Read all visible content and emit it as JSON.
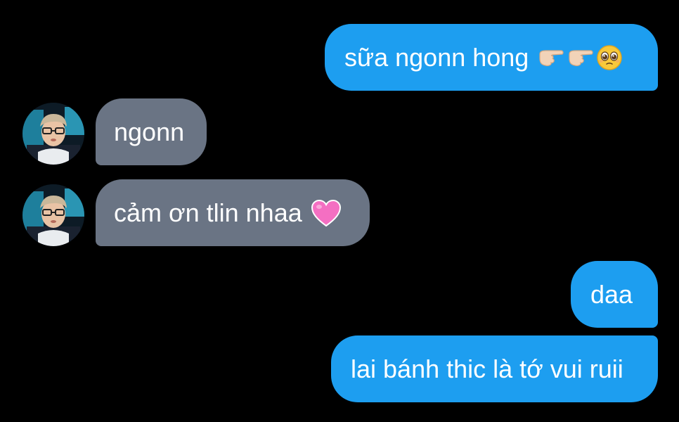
{
  "messages": [
    {
      "id": "m1",
      "direction": "outgoing",
      "text": "sữa ngonn hong",
      "emojis": [
        "backhand-index-pointing-right",
        "backhand-index-pointing-right",
        "pleading-face"
      ]
    },
    {
      "id": "m2",
      "direction": "incoming",
      "text": "ngonn",
      "emojis": []
    },
    {
      "id": "m3",
      "direction": "incoming",
      "text": "cảm ơn tlin nhaa",
      "emojis": [
        "pink-heart"
      ]
    },
    {
      "id": "m4",
      "direction": "outgoing",
      "text": "daa",
      "emojis": []
    },
    {
      "id": "m5",
      "direction": "outgoing",
      "text": "lai bánh thic là tớ vui ruii",
      "emojis": []
    }
  ],
  "colors": {
    "background": "#000000",
    "outgoing_bubble": "#1d9ef0",
    "incoming_bubble": "#6a7484",
    "text": "#ffffff"
  }
}
